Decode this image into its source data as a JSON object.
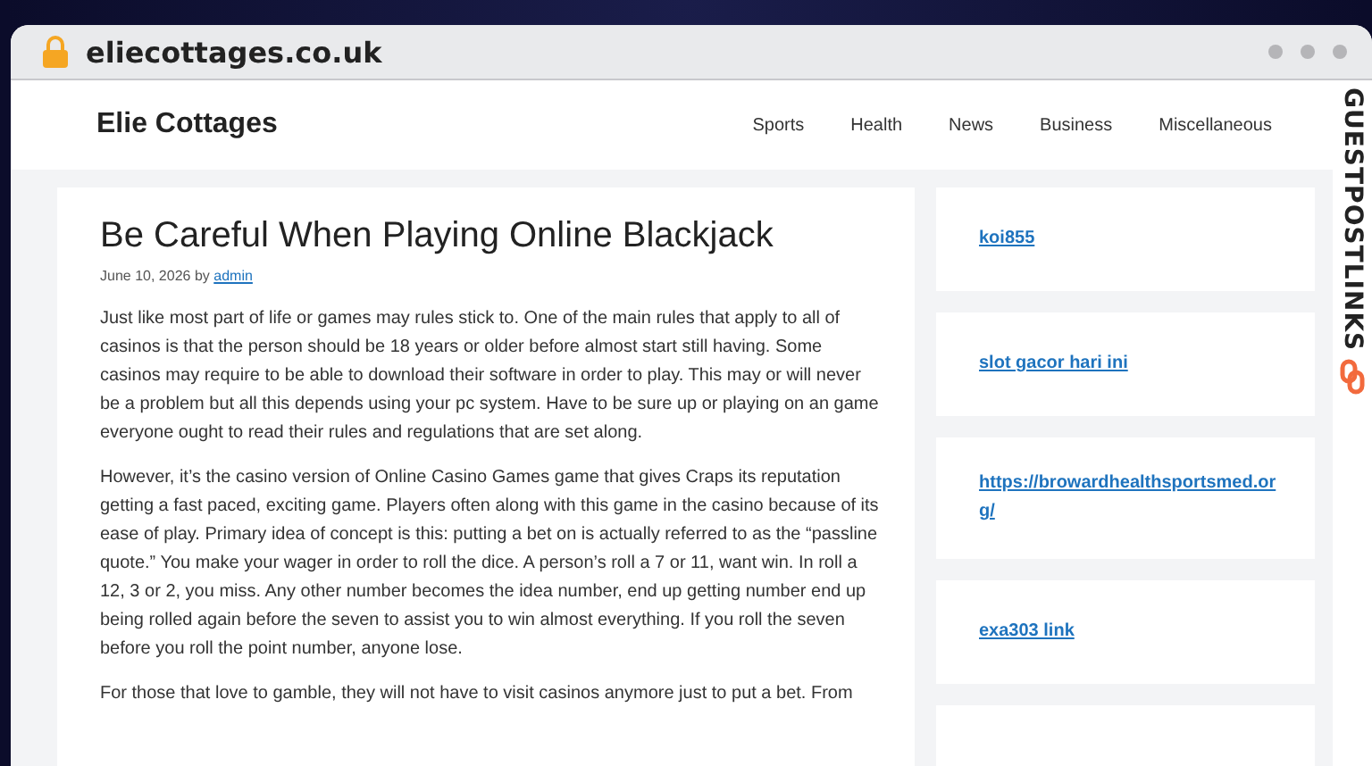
{
  "browser": {
    "address": "eliecottages.co.uk"
  },
  "site": {
    "title": "Elie Cottages",
    "nav": [
      {
        "label": "Sports"
      },
      {
        "label": "Health"
      },
      {
        "label": "News"
      },
      {
        "label": "Business"
      },
      {
        "label": "Miscellaneous"
      }
    ]
  },
  "article": {
    "title": "Be Careful When Playing Online Blackjack",
    "date": "June 10, 2026",
    "by": "by",
    "author": "admin",
    "paragraphs": [
      "Just like most part of life or games may rules stick to. One of the main rules that apply to all of casinos is that the person should be 18 years or older before almost start still having. Some casinos may require to be able to download their software in order to play. This may or will never be a problem but all this depends using your pc system. Have to be sure up or playing on an game everyone ought to read their rules and regulations that are set along.",
      "However, it’s the casino version of Online Casino Games game that gives Craps its reputation getting a fast paced, exciting game. Players often along with this game in the casino because of its ease of play. Primary idea of concept is this: putting a bet on is actually referred to as the “passline quote.” You make your wager in order to roll the dice. A person’s roll a 7 or 11, want win. In roll a 12, 3 or 2, you miss. Any other number becomes the idea number, end up getting number end up being rolled again before the seven to assist you to win almost everything. If you roll the seven before you roll the point number, anyone lose.",
      "For those that love to gamble, they will not have to visit casinos anymore just to put a bet. From"
    ]
  },
  "sidebar": {
    "links": [
      {
        "label": "koi855"
      },
      {
        "label": "slot gacor hari ini"
      },
      {
        "label": "https://browardhealthsportsmed.org/"
      },
      {
        "label": "exa303 link"
      }
    ]
  },
  "brand": {
    "label": "GUESTPOSTLINKS"
  }
}
